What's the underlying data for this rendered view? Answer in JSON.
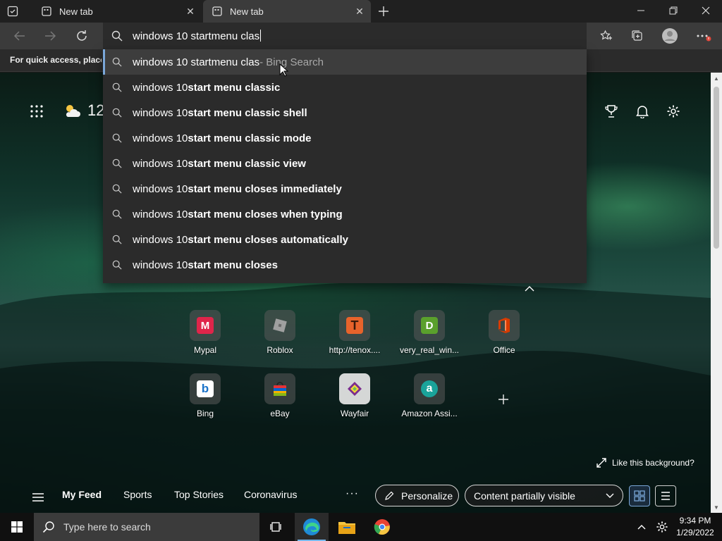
{
  "browser": {
    "tabs": [
      {
        "title": "New tab",
        "active": false
      },
      {
        "title": "New tab",
        "active": true
      }
    ],
    "address_query": "windows 10 startmenu clas",
    "favorites_bar_text": "For quick access, place y",
    "profile_badge_color": "#e0473b",
    "accent": "#7aa7d8"
  },
  "suggestions": [
    {
      "normal": "windows 10 startmenu clas",
      "bold": "",
      "muted": " - Bing Search",
      "selected": true
    },
    {
      "normal": "windows 10 ",
      "bold": "start menu clas",
      "bold2": "sic",
      "selected": false
    },
    {
      "normal": "windows 10 ",
      "bold": "start menu clas",
      "bold2": "sic shell",
      "selected": false
    },
    {
      "normal": "windows 10 ",
      "bold": "start menu clas",
      "bold2": "sic mode",
      "selected": false
    },
    {
      "normal": "windows 10 ",
      "bold": "start menu clas",
      "bold2": "sic view",
      "selected": false
    },
    {
      "normal": "windows 10 ",
      "bold": "start menu closes immediately",
      "bold2": "",
      "selected": false
    },
    {
      "normal": "windows 10 ",
      "bold": "start menu closes when typing",
      "bold2": "",
      "selected": false
    },
    {
      "normal": "windows 10 ",
      "bold": "start menu closes automatically",
      "bold2": "",
      "selected": false
    },
    {
      "normal": "windows 10 ",
      "bold": "start menu closes",
      "bold2": "",
      "selected": false
    }
  ],
  "ntp": {
    "weather_temp": "12",
    "quick_links": [
      {
        "label": "Mypal",
        "glyph": "M",
        "color": "#e0254a"
      },
      {
        "label": "Roblox",
        "glyph": "",
        "color": "#9a9a9a"
      },
      {
        "label": "http://tenox....",
        "glyph": "T",
        "color": "#e8632b"
      },
      {
        "label": "very_real_win...",
        "glyph": "D",
        "color": "#5aa02c"
      },
      {
        "label": "Office",
        "glyph": "",
        "color": "#d83b01"
      },
      {
        "label": "Bing",
        "glyph": "b",
        "color": "#ffffff"
      },
      {
        "label": "eBay",
        "glyph": "",
        "color": "#333333"
      },
      {
        "label": "Wayfair",
        "glyph": "",
        "color": "#7b2d8e"
      },
      {
        "label": "Amazon Assi...",
        "glyph": "a",
        "color": "#1aa39a"
      }
    ],
    "like_background": "Like this background?",
    "feed": {
      "tabs": [
        "My Feed",
        "Sports",
        "Top Stories",
        "Coronavirus"
      ],
      "more": "···",
      "personalize": "Personalize",
      "content_visibility": "Content partially visible"
    }
  },
  "taskbar": {
    "search_placeholder": "Type here to search",
    "time": "9:34 PM",
    "date": "1/29/2022"
  }
}
